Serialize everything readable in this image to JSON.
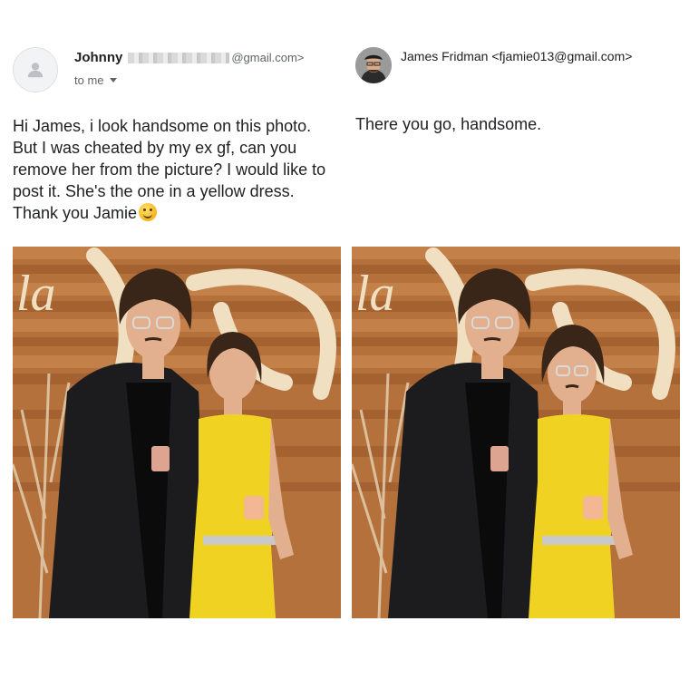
{
  "left_email": {
    "sender_name": "Johnny",
    "sender_email_suffix": "@gmail.com>",
    "recipient_label": "to me",
    "body_text": "Hi James, i look handsome on this photo. But I was cheated by my ex gf, can you remove her from the picture? I would like to post it. She's the one in a yellow dress. Thank you Jamie",
    "emoji_icon": "hugging-face-icon"
  },
  "right_email": {
    "sender_line": "James Fridman <fjamie013@gmail.com>",
    "reply_text": "There you go, handsome."
  },
  "photos": {
    "sign_text": "la",
    "colors": {
      "wood": "#b5713c",
      "sign": "#f1dfc2",
      "jacket": "#1c1c1e",
      "dress": "#f0d322",
      "skin": "#e2b08f",
      "hair": "#3a2618"
    }
  }
}
